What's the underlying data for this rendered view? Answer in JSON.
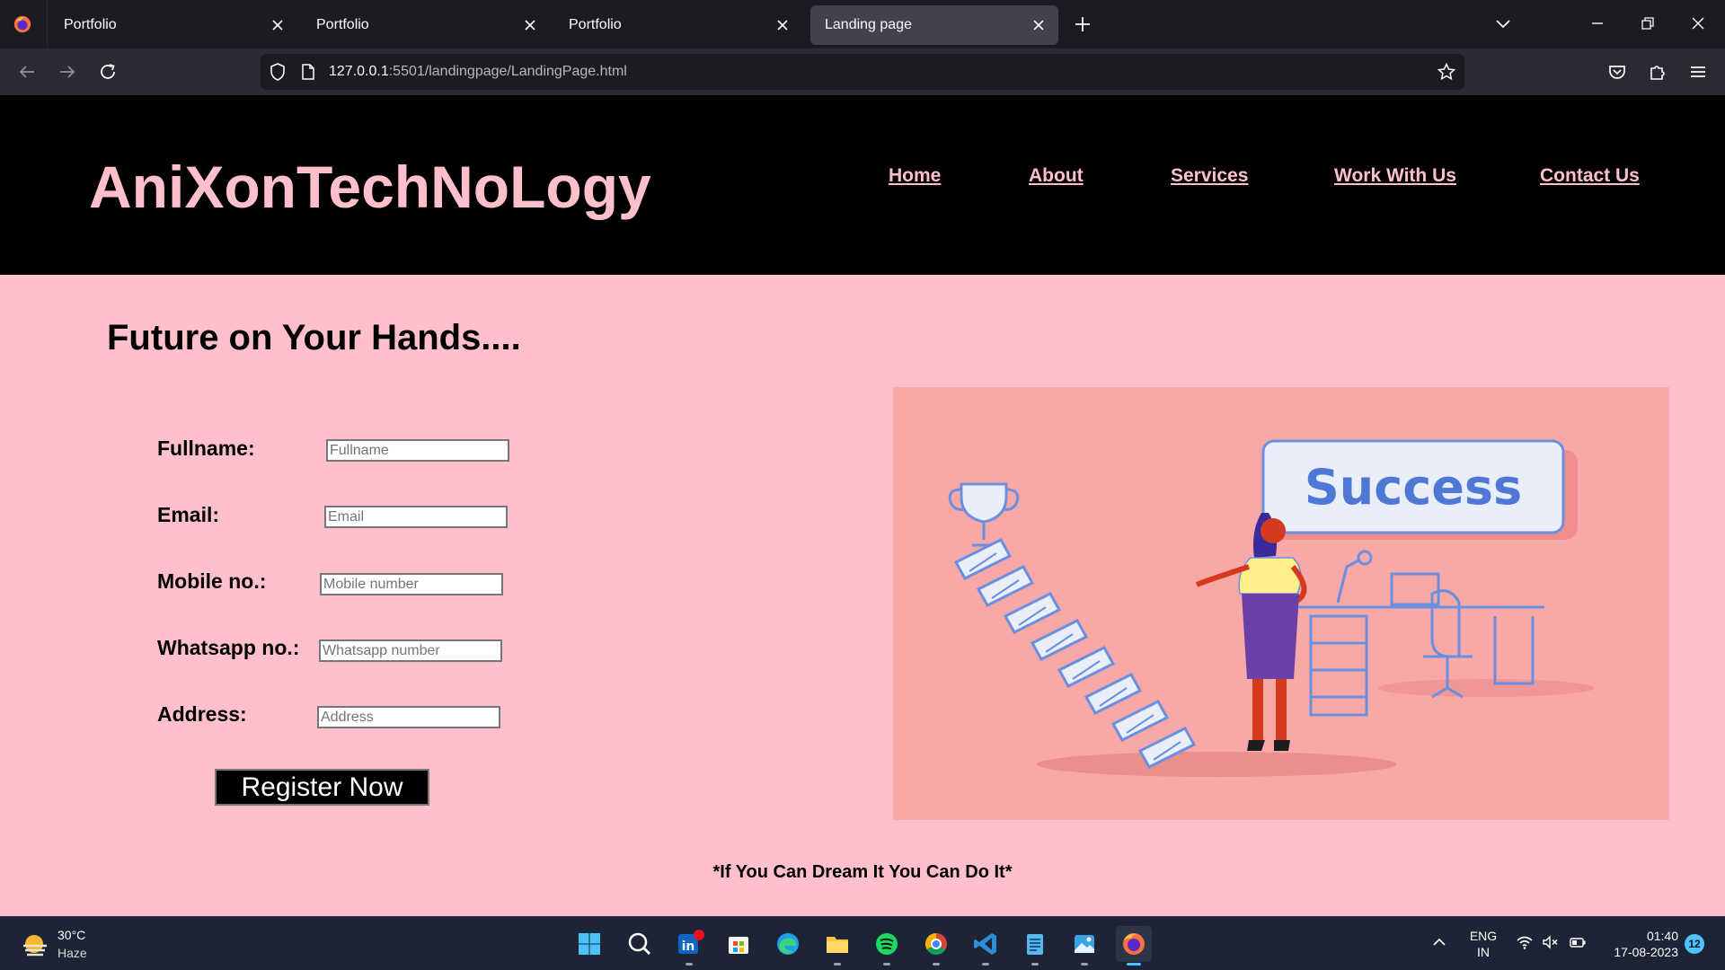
{
  "browser": {
    "tabs": [
      {
        "title": "Portfolio",
        "active": false
      },
      {
        "title": "Portfolio",
        "active": false
      },
      {
        "title": "Portfolio",
        "active": false
      },
      {
        "title": "Landing page",
        "active": true
      }
    ],
    "url_host": "127.0.0.1",
    "url_path": ":5501/landingpage/LandingPage.html"
  },
  "site": {
    "logo": "AniXonTechNoLogy",
    "nav": [
      "Home",
      "About",
      "Services",
      "Work With Us",
      "Contact Us"
    ],
    "hero_title": "Future on Your Hands....",
    "form": {
      "fields": [
        {
          "label": "Fullname:",
          "placeholder": "Fullname"
        },
        {
          "label": "Email:",
          "placeholder": "Email"
        },
        {
          "label": "Mobile no.:",
          "placeholder": "Mobile number"
        },
        {
          "label": "Whatsapp no.:",
          "placeholder": "Whatsapp number"
        },
        {
          "label": "Address:",
          "placeholder": "Address"
        }
      ],
      "submit_label": "Register Now"
    },
    "illustration_sign": "Success",
    "tagline": "*If You Can Dream It You Can Do It*"
  },
  "taskbar": {
    "weather_temp": "30°C",
    "weather_desc": "Haze",
    "apps": [
      "start",
      "search",
      "linkedin",
      "microsoft-store",
      "edge",
      "file-explorer",
      "spotify",
      "chrome",
      "vs-code",
      "notepad",
      "photos",
      "firefox"
    ],
    "lang_line1": "ENG",
    "lang_line2": "IN",
    "time": "01:40",
    "date": "17-08-2023",
    "notification_count": "12"
  },
  "colors": {
    "page_bg": "#ffc0cb",
    "header_bg": "#000000",
    "accent_text": "#ffc0cb",
    "illustration_bg": "#f8a8a6",
    "taskbar_bg": "#1d2436"
  }
}
